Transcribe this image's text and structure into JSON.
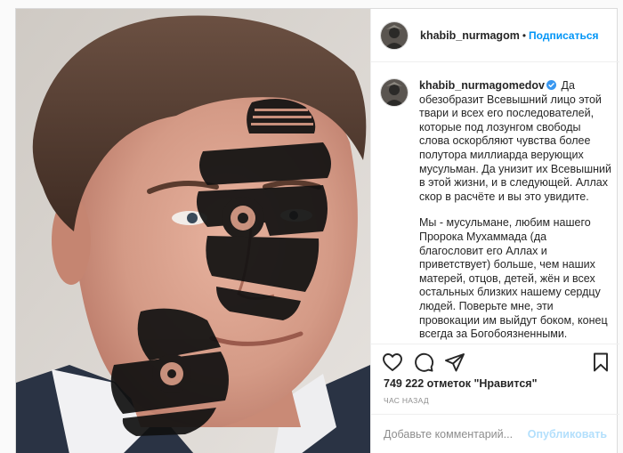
{
  "header": {
    "username": "khabib_nurmagom",
    "separator": "•",
    "follow_label": "Подписаться"
  },
  "caption": {
    "username": "khabib_nurmagomedov",
    "paragraph1": "Да обезобразит Всевышний лицо этой твари и всех его последователей, которые под лозунгом свободы слова оскорбляют чувства более полутора миллиарда верующих мусульман. Да унизит их Всевышний в этой жизни, и в следующей. Аллах скор в расчёте и вы это увидите.",
    "paragraph2": "Мы - мусульмане, любим нашего Пророка Мухаммада (да благословит его Аллах и приветствует) больше, чем наших матерей, отцов, детей, жён и всех остальных близких нашему сердцу людей. Поверьте мне, эти провокации им выйдут боком, конец всегда за Богобоязненными."
  },
  "stats": {
    "likes": "749 222 отметок \"Нравится\"",
    "time": "ЧАС НАЗАД"
  },
  "comment": {
    "placeholder": "Добавьте комментарий...",
    "publish_label": "Опубликовать"
  },
  "colors": {
    "accent": "#0095f6",
    "publish_disabled": "#b2dffc",
    "verified": "#3897f0"
  },
  "icons": [
    "heart-icon",
    "comment-icon",
    "share-icon",
    "bookmark-icon",
    "verified-badge-icon"
  ]
}
